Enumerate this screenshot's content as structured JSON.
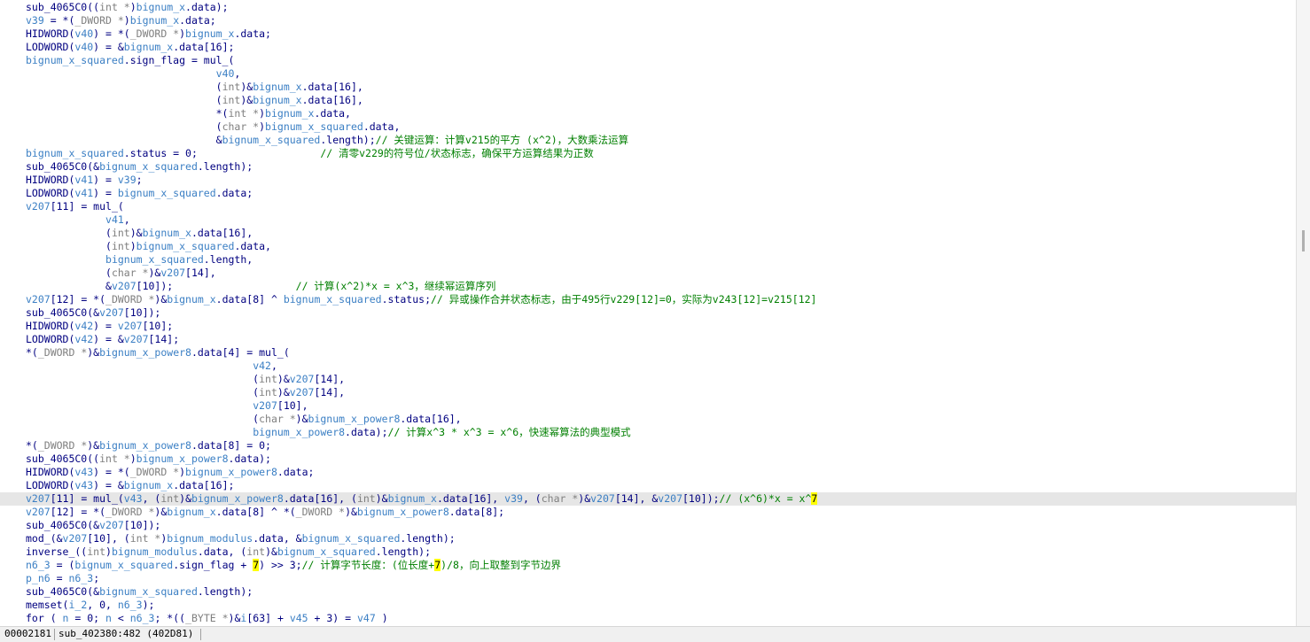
{
  "editor": {
    "highlight_color": "#ffff00",
    "scroll_position": 0.38,
    "lines": [
      [
        [
          "sub_4065C0((",
          ""
        ],
        [
          "int *",
          "cast"
        ],
        [
          ")",
          ""
        ],
        [
          "bignum_x",
          "var"
        ],
        [
          ".data);",
          ""
        ]
      ],
      [
        [
          "v39",
          "var"
        ],
        [
          " = *(",
          ""
        ],
        [
          "_DWORD *",
          "cast"
        ],
        [
          ")",
          ""
        ],
        [
          "bignum_x",
          "var"
        ],
        [
          ".data;",
          ""
        ]
      ],
      [
        [
          "HIDWORD(",
          ""
        ],
        [
          "v40",
          "var"
        ],
        [
          ") = *(",
          ""
        ],
        [
          "_DWORD *",
          "cast"
        ],
        [
          ")",
          ""
        ],
        [
          "bignum_x",
          "var"
        ],
        [
          ".data;",
          ""
        ]
      ],
      [
        [
          "LODWORD(",
          ""
        ],
        [
          "v40",
          "var"
        ],
        [
          ") = &",
          ""
        ],
        [
          "bignum_x",
          "var"
        ],
        [
          ".data[16];",
          ""
        ]
      ],
      [
        [
          "bignum_x_squared",
          "var"
        ],
        [
          ".sign_flag = mul_(",
          ""
        ]
      ],
      [
        [
          "                               ",
          ""
        ],
        [
          "v40",
          "var"
        ],
        [
          ",",
          ""
        ]
      ],
      [
        [
          "                               (",
          ""
        ],
        [
          "int",
          "cast"
        ],
        [
          ")&",
          ""
        ],
        [
          "bignum_x",
          "var"
        ],
        [
          ".data[16],",
          ""
        ]
      ],
      [
        [
          "                               (",
          ""
        ],
        [
          "int",
          "cast"
        ],
        [
          ")&",
          ""
        ],
        [
          "bignum_x",
          "var"
        ],
        [
          ".data[16],",
          ""
        ]
      ],
      [
        [
          "                               *(",
          ""
        ],
        [
          "int *",
          "cast"
        ],
        [
          ")",
          ""
        ],
        [
          "bignum_x",
          "var"
        ],
        [
          ".data,",
          ""
        ]
      ],
      [
        [
          "                               (",
          ""
        ],
        [
          "char *",
          "cast"
        ],
        [
          ")",
          ""
        ],
        [
          "bignum_x_squared",
          "var"
        ],
        [
          ".data,",
          ""
        ]
      ],
      [
        [
          "                               &",
          ""
        ],
        [
          "bignum_x_squared",
          "var"
        ],
        [
          ".length);",
          ""
        ],
        [
          "// 关键运算：计算v215的平方 (x^2)，大数乘法运算",
          "cmt"
        ]
      ],
      [
        [
          "bignum_x_squared",
          "var"
        ],
        [
          ".status = 0;                    ",
          ""
        ],
        [
          "// 清零v229的符号位/状态标志，确保平方运算结果为正数",
          "cmt"
        ]
      ],
      [
        [
          "sub_4065C0(&",
          ""
        ],
        [
          "bignum_x_squared",
          "var"
        ],
        [
          ".length);",
          ""
        ]
      ],
      [
        [
          "HIDWORD(",
          ""
        ],
        [
          "v41",
          "var"
        ],
        [
          ") = ",
          ""
        ],
        [
          "v39",
          "var"
        ],
        [
          ";",
          ""
        ]
      ],
      [
        [
          "LODWORD(",
          ""
        ],
        [
          "v41",
          "var"
        ],
        [
          ") = ",
          ""
        ],
        [
          "bignum_x_squared",
          "var"
        ],
        [
          ".data;",
          ""
        ]
      ],
      [
        [
          "v207",
          "var"
        ],
        [
          "[11] = mul_(",
          ""
        ]
      ],
      [
        [
          "             ",
          ""
        ],
        [
          "v41",
          "var"
        ],
        [
          ",",
          ""
        ]
      ],
      [
        [
          "             (",
          ""
        ],
        [
          "int",
          "cast"
        ],
        [
          ")&",
          ""
        ],
        [
          "bignum_x",
          "var"
        ],
        [
          ".data[16],",
          ""
        ]
      ],
      [
        [
          "             (",
          ""
        ],
        [
          "int",
          "cast"
        ],
        [
          ")",
          ""
        ],
        [
          "bignum_x_squared",
          "var"
        ],
        [
          ".data,",
          ""
        ]
      ],
      [
        [
          "             ",
          ""
        ],
        [
          "bignum_x_squared",
          "var"
        ],
        [
          ".length,",
          ""
        ]
      ],
      [
        [
          "             (",
          ""
        ],
        [
          "char *",
          "cast"
        ],
        [
          ")&",
          ""
        ],
        [
          "v207",
          "var"
        ],
        [
          "[14],",
          ""
        ]
      ],
      [
        [
          "             &",
          ""
        ],
        [
          "v207",
          "var"
        ],
        [
          "[10]);                    ",
          ""
        ],
        [
          "// 计算(x^2)*x = x^3，继续幂运算序列",
          "cmt"
        ]
      ],
      [
        [
          "v207",
          "var"
        ],
        [
          "[12] = *(",
          ""
        ],
        [
          "_DWORD *",
          "cast"
        ],
        [
          ")&",
          ""
        ],
        [
          "bignum_x",
          "var"
        ],
        [
          ".data[8] ^ ",
          ""
        ],
        [
          "bignum_x_squared",
          "var"
        ],
        [
          ".status;",
          ""
        ],
        [
          "// 异或操作合并状态标志，由于495行v229[12]=0，实际为v243[12]=v215[12]",
          "cmt"
        ]
      ],
      [
        [
          "sub_4065C0(&",
          ""
        ],
        [
          "v207",
          "var"
        ],
        [
          "[10]);",
          ""
        ]
      ],
      [
        [
          "HIDWORD(",
          ""
        ],
        [
          "v42",
          "var"
        ],
        [
          ") = ",
          ""
        ],
        [
          "v207",
          "var"
        ],
        [
          "[10];",
          ""
        ]
      ],
      [
        [
          "LODWORD(",
          ""
        ],
        [
          "v42",
          "var"
        ],
        [
          ") = &",
          ""
        ],
        [
          "v207",
          "var"
        ],
        [
          "[14];",
          ""
        ]
      ],
      [
        [
          "*(",
          ""
        ],
        [
          "_DWORD *",
          "cast"
        ],
        [
          ")&",
          ""
        ],
        [
          "bignum_x_power8",
          "var"
        ],
        [
          ".data[4] = mul_(",
          ""
        ]
      ],
      [
        [
          "                                     ",
          ""
        ],
        [
          "v42",
          "var"
        ],
        [
          ",",
          ""
        ]
      ],
      [
        [
          "                                     (",
          ""
        ],
        [
          "int",
          "cast"
        ],
        [
          ")&",
          ""
        ],
        [
          "v207",
          "var"
        ],
        [
          "[14],",
          ""
        ]
      ],
      [
        [
          "                                     (",
          ""
        ],
        [
          "int",
          "cast"
        ],
        [
          ")&",
          ""
        ],
        [
          "v207",
          "var"
        ],
        [
          "[14],",
          ""
        ]
      ],
      [
        [
          "                                     ",
          ""
        ],
        [
          "v207",
          "var"
        ],
        [
          "[10],",
          ""
        ]
      ],
      [
        [
          "                                     (",
          ""
        ],
        [
          "char *",
          "cast"
        ],
        [
          ")&",
          ""
        ],
        [
          "bignum_x_power8",
          "var"
        ],
        [
          ".data[16],",
          ""
        ]
      ],
      [
        [
          "                                     ",
          ""
        ],
        [
          "bignum_x_power8",
          "var"
        ],
        [
          ".data);",
          ""
        ],
        [
          "// 计算x^3 * x^3 = x^6，快速幂算法的典型模式",
          "cmt"
        ]
      ],
      [
        [
          "*(",
          ""
        ],
        [
          "_DWORD *",
          "cast"
        ],
        [
          ")&",
          ""
        ],
        [
          "bignum_x_power8",
          "var"
        ],
        [
          ".data[8] = 0;",
          ""
        ]
      ],
      [
        [
          "sub_4065C0((",
          ""
        ],
        [
          "int *",
          "cast"
        ],
        [
          ")",
          ""
        ],
        [
          "bignum_x_power8",
          "var"
        ],
        [
          ".data);",
          ""
        ]
      ],
      [
        [
          "HIDWORD(",
          ""
        ],
        [
          "v43",
          "var"
        ],
        [
          ") = *(",
          ""
        ],
        [
          "_DWORD *",
          "cast"
        ],
        [
          ")",
          ""
        ],
        [
          "bignum_x_power8",
          "var"
        ],
        [
          ".data;",
          ""
        ]
      ],
      [
        [
          "LODWORD(",
          ""
        ],
        [
          "v43",
          "var"
        ],
        [
          ") = &",
          ""
        ],
        [
          "bignum_x",
          "var"
        ],
        [
          ".data[16];",
          ""
        ]
      ],
      [
        [
          "v207",
          "var"
        ],
        [
          "[11] = mul_(",
          ""
        ],
        [
          "v43",
          "var"
        ],
        [
          ", (",
          ""
        ],
        [
          "int",
          "cast"
        ],
        [
          ")&",
          ""
        ],
        [
          "bignum_x_power8",
          "var"
        ],
        [
          ".data[16], (",
          ""
        ],
        [
          "int",
          "cast"
        ],
        [
          ")&",
          ""
        ],
        [
          "bignum_x",
          "var"
        ],
        [
          ".data[16], ",
          ""
        ],
        [
          "v39",
          "var"
        ],
        [
          ", (",
          ""
        ],
        [
          "char *",
          "cast"
        ],
        [
          ")&",
          ""
        ],
        [
          "v207",
          "var"
        ],
        [
          "[14], &",
          ""
        ],
        [
          "v207",
          "var"
        ],
        [
          "[10]);",
          ""
        ],
        [
          "// (x^6)*x = x^",
          "cmt"
        ],
        [
          "7",
          "mark"
        ]
      ],
      [
        [
          "v207",
          "var"
        ],
        [
          "[12] = *(",
          ""
        ],
        [
          "_DWORD *",
          "cast"
        ],
        [
          ")&",
          ""
        ],
        [
          "bignum_x",
          "var"
        ],
        [
          ".data[8] ^ *(",
          ""
        ],
        [
          "_DWORD *",
          "cast"
        ],
        [
          ")&",
          ""
        ],
        [
          "bignum_x_power8",
          "var"
        ],
        [
          ".data[8];",
          ""
        ]
      ],
      [
        [
          "sub_4065C0(&",
          ""
        ],
        [
          "v207",
          "var"
        ],
        [
          "[10]);",
          ""
        ]
      ],
      [
        [
          "mod_(&",
          ""
        ],
        [
          "v207",
          "var"
        ],
        [
          "[10], (",
          ""
        ],
        [
          "int *",
          "cast"
        ],
        [
          ")",
          ""
        ],
        [
          "bignum_modulus",
          "var"
        ],
        [
          ".data, &",
          ""
        ],
        [
          "bignum_x_squared",
          "var"
        ],
        [
          ".length);",
          ""
        ]
      ],
      [
        [
          "inverse_((",
          ""
        ],
        [
          "int",
          "cast"
        ],
        [
          ")",
          ""
        ],
        [
          "bignum_modulus",
          "var"
        ],
        [
          ".data, (",
          ""
        ],
        [
          "int",
          "cast"
        ],
        [
          ")&",
          ""
        ],
        [
          "bignum_x_squared",
          "var"
        ],
        [
          ".length);",
          ""
        ]
      ],
      [
        [
          "n6_3",
          "var"
        ],
        [
          " = (",
          ""
        ],
        [
          "bignum_x_squared",
          "var"
        ],
        [
          ".sign_flag + ",
          ""
        ],
        [
          "7",
          "mark"
        ],
        [
          ") >> 3;",
          ""
        ],
        [
          "// 计算字节长度：(位长度+",
          "cmt"
        ],
        [
          "7",
          "mark"
        ],
        [
          ")/8，向上取整到字节边界",
          "cmt"
        ]
      ],
      [
        [
          "p_n6",
          "var"
        ],
        [
          " = ",
          ""
        ],
        [
          "n6_3",
          "var"
        ],
        [
          ";",
          ""
        ]
      ],
      [
        [
          "sub_4065C0(&",
          ""
        ],
        [
          "bignum_x_squared",
          "var"
        ],
        [
          ".length);",
          ""
        ]
      ],
      [
        [
          "memset(",
          ""
        ],
        [
          "i_2",
          "var"
        ],
        [
          ", 0, ",
          ""
        ],
        [
          "n6_3",
          "var"
        ],
        [
          ");",
          ""
        ]
      ],
      [
        [
          "for ( ",
          ""
        ],
        [
          "n",
          "var"
        ],
        [
          " = 0; ",
          ""
        ],
        [
          "n",
          "var"
        ],
        [
          " < ",
          ""
        ],
        [
          "n6_3",
          "var"
        ],
        [
          "; *((",
          ""
        ],
        [
          "_BYTE *",
          "cast"
        ],
        [
          ")&",
          ""
        ],
        [
          "i",
          "var"
        ],
        [
          "[63] + ",
          ""
        ],
        [
          "v45",
          "var"
        ],
        [
          " + 3) = ",
          ""
        ],
        [
          "v47",
          "var"
        ],
        [
          " )",
          ""
        ]
      ]
    ]
  },
  "status_bar": {
    "offset": "00002181",
    "location": "sub_402380:482 (402D81)"
  }
}
